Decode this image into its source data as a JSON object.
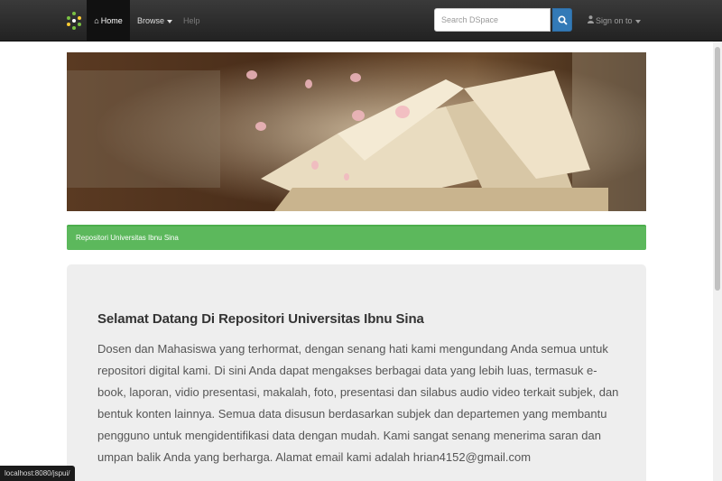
{
  "navbar": {
    "home_label": "Home",
    "browse_label": "Browse",
    "help_label": "Help",
    "search_placeholder": "Search DSpace",
    "signin_label": "Sign on to"
  },
  "breadcrumb": {
    "label": "Repositori Universitas Ibnu Sina"
  },
  "intro": {
    "title": "Selamat Datang Di Repositori Universitas Ibnu Sina",
    "body": "Dosen dan Mahasiswa yang terhormat, dengan senang hati kami mengundang Anda semua untuk repositori digital kami. Di sini Anda dapat mengakses berbagai data yang lebih luas, termasuk e-book, laporan, vidio presentasi, makalah, foto, presentasi dan silabus audio video terkait subjek, dan bentuk konten lainnya. Semua data disusun berdasarkan subjek dan departemen yang membantu pengguno untuk mengidentifikasi data dengan mudah. Kami sangat senang menerima saran dan umpan balik Anda yang berharga. Alamat email kami adalah hrian4152@gmail.com"
  },
  "status_bar": {
    "text": "localhost:8080/jspui/"
  },
  "colors": {
    "navbar": "#222222",
    "search_button": "#337ab7",
    "breadcrumb_bar": "#5cb85c",
    "jumbotron": "#eeeeee"
  },
  "icons": [
    "dspace-logo-icon",
    "home-icon",
    "search-icon",
    "user-icon"
  ]
}
